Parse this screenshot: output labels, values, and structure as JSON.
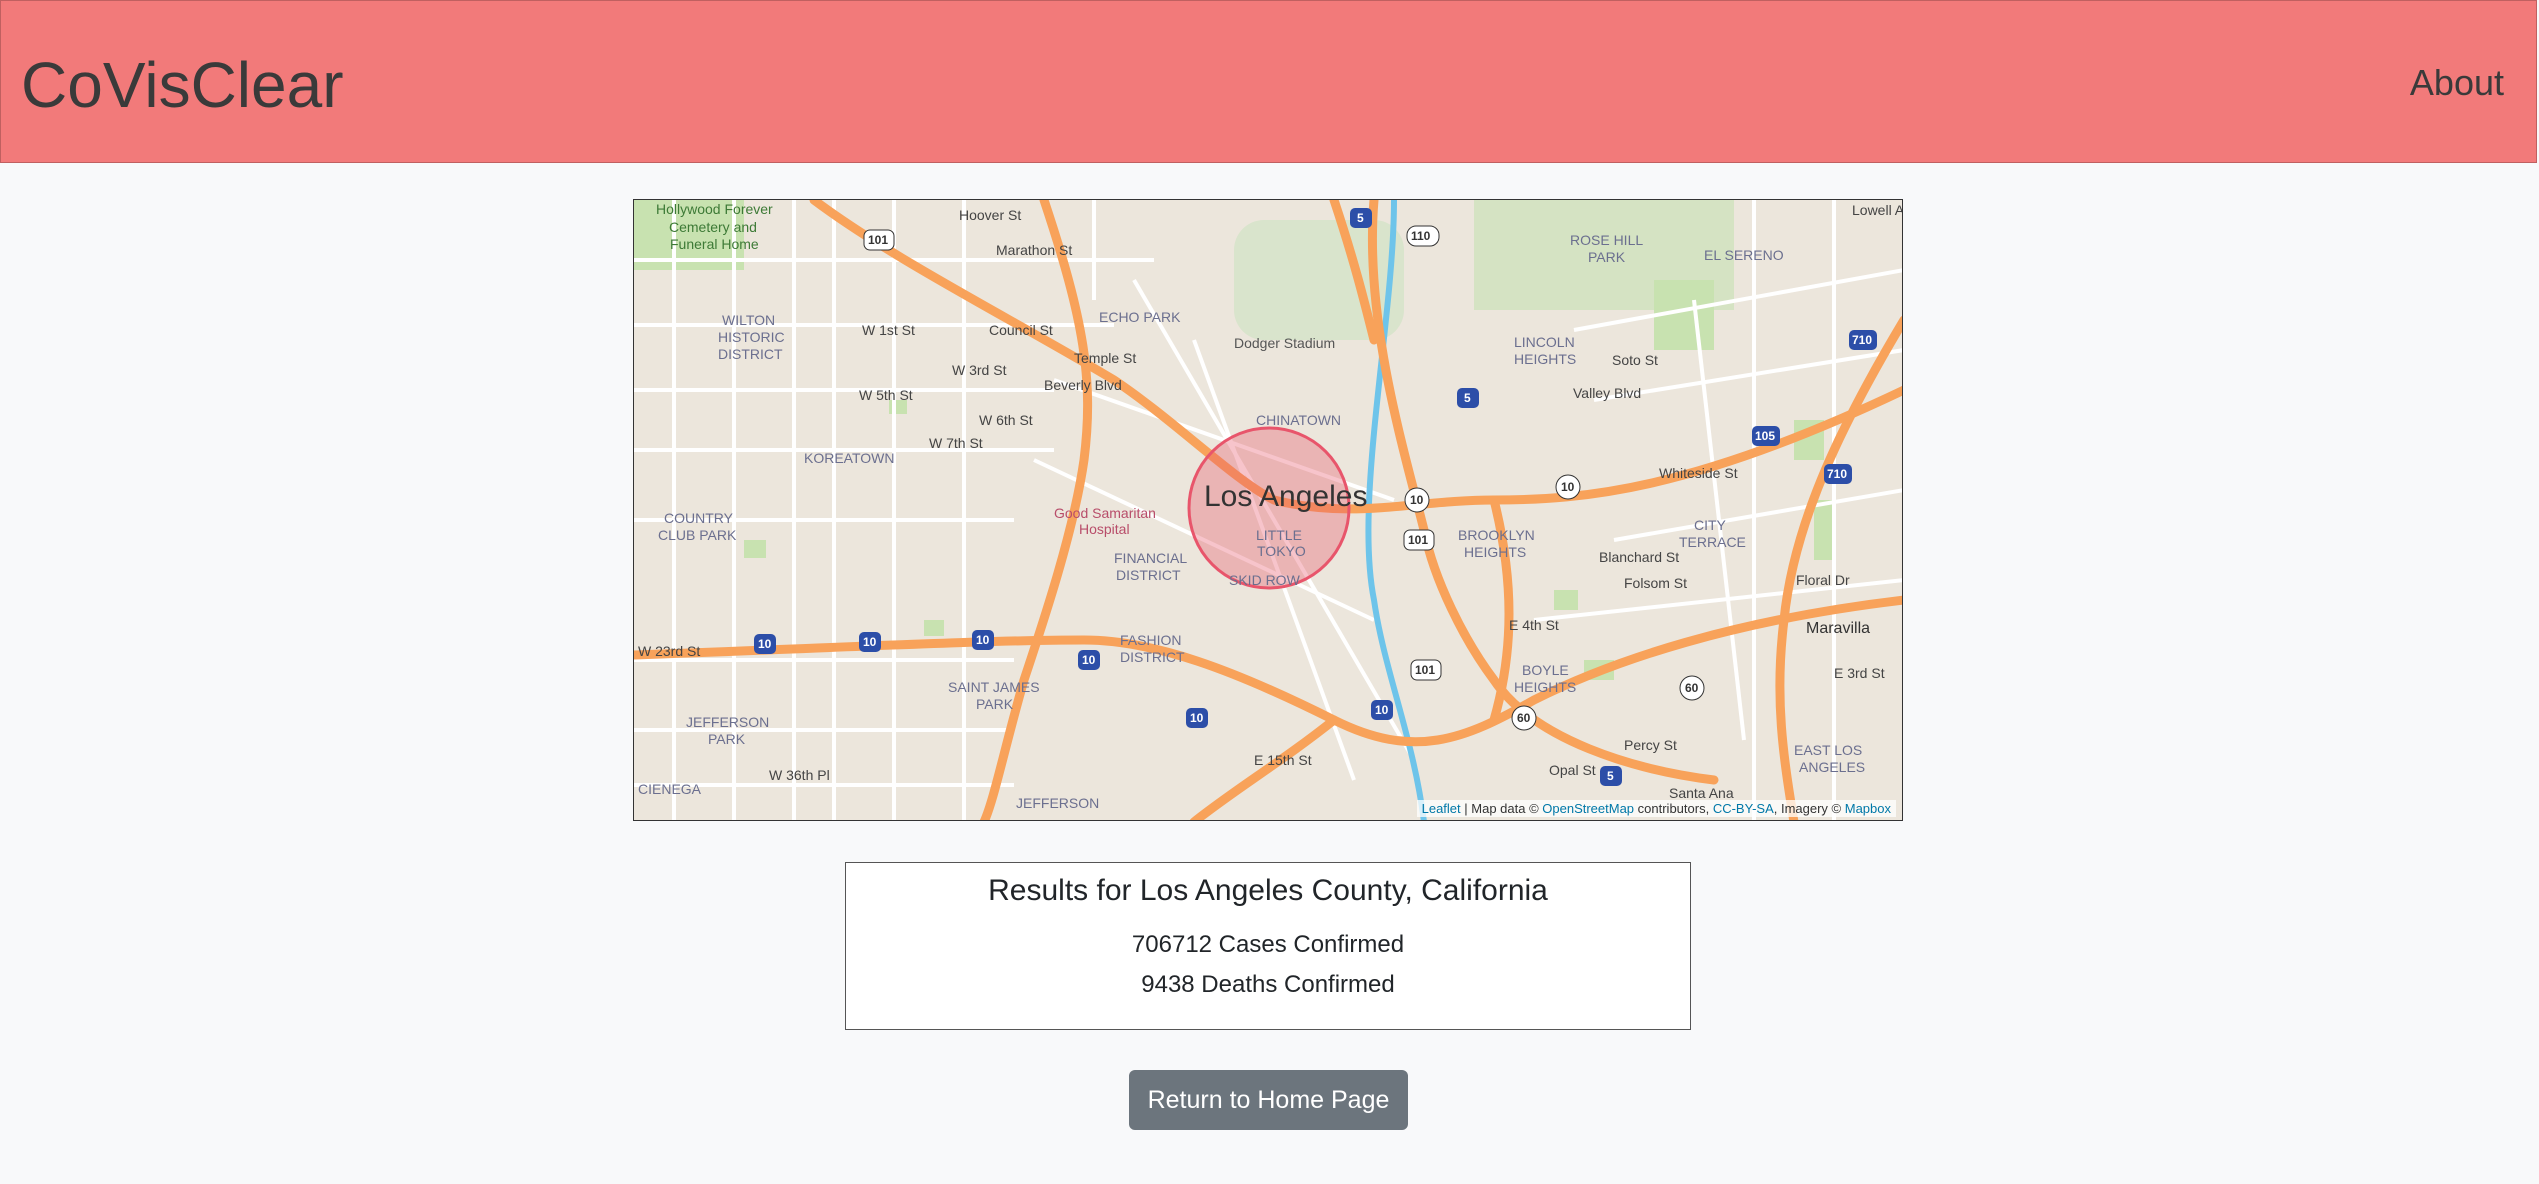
{
  "header": {
    "brand": "CoVisClear",
    "about": "About"
  },
  "map": {
    "labels": {
      "city": "Los Angeles",
      "hollywood_cemetery_1": "Hollywood Forever",
      "hollywood_cemetery_2": "Cemetery and",
      "hollywood_cemetery_3": "Funeral Home",
      "echo_park": "ECHO PARK",
      "dodger_stadium": "Dodger Stadium",
      "chinatown": "CHINATOWN",
      "wilton_1": "WILTON",
      "wilton_2": "HISTORIC",
      "wilton_3": "DISTRICT",
      "koreatown": "KOREATOWN",
      "country_club_1": "COUNTRY",
      "country_club_2": "CLUB PARK",
      "good_sam_1": "Good Samaritan",
      "good_sam_2": "Hospital",
      "financial_1": "FINANCIAL",
      "financial_2": "DISTRICT",
      "little_tokyo_1": "LITTLE",
      "little_tokyo_2": "TOKYO",
      "skid_row": "SKID ROW",
      "fashion_1": "FASHION",
      "fashion_2": "DISTRICT",
      "saint_james_1": "SAINT JAMES",
      "saint_james_2": "PARK",
      "jefferson_park_1": "JEFFERSON",
      "jefferson_park_2": "PARK",
      "jefferson_park_b": "JEFFERSON",
      "cienega": "CIENEGA",
      "rose_hill_1": "ROSE HILL",
      "rose_hill_2": "PARK",
      "el_sereno": "EL SERENO",
      "lincoln_1": "LINCOLN",
      "lincoln_2": "HEIGHTS",
      "city_terrace_1": "CITY",
      "city_terrace_2": "TERRACE",
      "brooklyn_1": "BROOKLYN",
      "brooklyn_2": "HEIGHTS",
      "boyle_1": "BOYLE",
      "boyle_2": "HEIGHTS",
      "east_la_1": "EAST LOS",
      "east_la_2": "ANGELES",
      "maravilla": "Maravilla",
      "valley_blvd": "Valley Blvd",
      "whiteside": "Whiteside St",
      "temple": "Temple St",
      "beverly": "Beverly Blvd",
      "w3rd": "W 3rd St",
      "w6th": "W 6th St",
      "w7th": "W 7th St",
      "w1st": "W 1st St",
      "w5th": "W 5th St",
      "w23rd": "W 23rd St",
      "w36th": "W 36th Pl",
      "e15th": "E 15th St",
      "e4th": "E 4th St",
      "e3rd": "E 3rd St",
      "floral": "Floral Dr",
      "percy": "Percy St",
      "opal": "Opal St",
      "santa_ana": "Santa Ana",
      "council": "Council St",
      "marathon": "Marathon St",
      "hoover": "Hoover St",
      "lowell": "Lowell Ave",
      "blanchard": "Blanchard St",
      "folsom": "Folsom St",
      "soto": "Soto St"
    },
    "shields": {
      "i10": "10",
      "i5": "5",
      "i110": "110",
      "us101": "101",
      "i710": "710",
      "i105": "105",
      "ca60": "60",
      "ca10": "10"
    },
    "attribution": {
      "leaflet": "Leaflet",
      "sep1": " | Map data © ",
      "osm": "OpenStreetMap",
      "contributors": " contributors, ",
      "ccbysa": "CC-BY-SA",
      "imagery": ", Imagery © ",
      "mapbox": "Mapbox"
    }
  },
  "results": {
    "title": "Results for Los Angeles County, California",
    "cases": "706712 Cases Confirmed",
    "deaths": "9438 Deaths Confirmed"
  },
  "buttons": {
    "home": "Return to Home Page"
  },
  "colors": {
    "navbar": "#f27a7a",
    "button": "#6c757d",
    "highway": "#f8a25a",
    "river": "#6ec4ea",
    "circle": "#e8556b"
  }
}
